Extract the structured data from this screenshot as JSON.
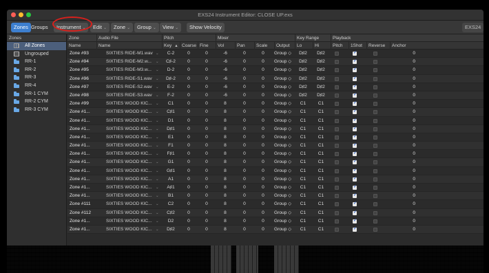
{
  "window": {
    "title": "EXS24 Instrument Editor: CLOSE UP.exs"
  },
  "toolbar": {
    "zones_label": "Zones",
    "groups_label": "Groups",
    "instrument_label": "Instrument",
    "edit_label": "Edit",
    "zone_label": "Zone",
    "group_label": "Group",
    "view_label": "View",
    "show_velocity_label": "Show Velocity",
    "badge": "EXS24"
  },
  "sidebar": {
    "header": "Zones",
    "items": [
      {
        "label": "All Zones",
        "icon": "grid-icon",
        "selected": true
      },
      {
        "label": "Ungrouped",
        "icon": "box-icon"
      },
      {
        "label": "RR-1",
        "icon": "folder-icon"
      },
      {
        "label": "RR-2",
        "icon": "folder-icon"
      },
      {
        "label": "RR-3",
        "icon": "folder-icon"
      },
      {
        "label": "RR-4",
        "icon": "folder-icon"
      },
      {
        "label": "RR-1 CYM",
        "icon": "folder-icon"
      },
      {
        "label": "RR-2 CYM",
        "icon": "folder-icon"
      },
      {
        "label": "RR-3 CYM",
        "icon": "folder-icon"
      }
    ]
  },
  "table": {
    "groups": {
      "zone": "Zone",
      "audio_file": "Audio File",
      "pitch": "Pitch",
      "mixer": "Mixer",
      "key_range": "Key Range",
      "playback": "Playback"
    },
    "columns": {
      "name": "Name",
      "file_name": "Name",
      "key": "Key",
      "coarse": "Coarse",
      "fine": "Fine",
      "vol": "Vol",
      "pan": "Pan",
      "scale": "Scale",
      "output": "Output",
      "lo": "Lo",
      "hi": "Hi",
      "pitch": "Pitch",
      "oneshot": "1Shot",
      "reverse": "Reverse",
      "anchor": "Anchor"
    },
    "rows": [
      {
        "zone": "Zone #93",
        "file": "SIXTIES RIDE-M1.wav",
        "key": "C-2",
        "coarse": "0",
        "fine": "0",
        "vol": "-6",
        "pan": "0",
        "scale": "0",
        "output": "Group ◇",
        "lo": "D♯2",
        "hi": "D♯2",
        "anchor": "0"
      },
      {
        "zone": "Zone #94",
        "file": "SIXTIES RIDE-M2.w...",
        "key": "C♯-2",
        "coarse": "0",
        "fine": "0",
        "vol": "-6",
        "pan": "0",
        "scale": "0",
        "output": "Group ◇",
        "lo": "D♯2",
        "hi": "D♯2",
        "anchor": "0"
      },
      {
        "zone": "Zone #95",
        "file": "SIXTIES RIDE-M3.w...",
        "key": "D-2",
        "coarse": "0",
        "fine": "0",
        "vol": "-6",
        "pan": "0",
        "scale": "0",
        "output": "Group ◇",
        "lo": "D♯2",
        "hi": "D♯2",
        "anchor": "0"
      },
      {
        "zone": "Zone #96",
        "file": "SIXTIES RIDE-S1.wav",
        "key": "D♯-2",
        "coarse": "0",
        "fine": "0",
        "vol": "-6",
        "pan": "0",
        "scale": "0",
        "output": "Group ◇",
        "lo": "D♯2",
        "hi": "D♯2",
        "anchor": "0"
      },
      {
        "zone": "Zone #97",
        "file": "SIXTIES RIDE-S2.wav",
        "key": "E-2",
        "coarse": "0",
        "fine": "0",
        "vol": "-6",
        "pan": "0",
        "scale": "0",
        "output": "Group ◇",
        "lo": "D♯2",
        "hi": "D♯2",
        "anchor": "0"
      },
      {
        "zone": "Zone #98",
        "file": "SIXTIES RIDE-S3.wav",
        "key": "F-2",
        "coarse": "0",
        "fine": "0",
        "vol": "-6",
        "pan": "0",
        "scale": "0",
        "output": "Group ◇",
        "lo": "D♯2",
        "hi": "D♯2",
        "anchor": "0"
      },
      {
        "zone": "Zone #99",
        "file": "SIXTIES WOOD KIC...",
        "key": "C1",
        "coarse": "0",
        "fine": "0",
        "vol": "8",
        "pan": "0",
        "scale": "0",
        "output": "Group ◇",
        "lo": "C1",
        "hi": "C1",
        "anchor": "0"
      },
      {
        "zone": "Zone #1...",
        "file": "SIXTIES WOOD KIC...",
        "key": "C♯1",
        "coarse": "0",
        "fine": "0",
        "vol": "8",
        "pan": "0",
        "scale": "0",
        "output": "Group ◇",
        "lo": "C1",
        "hi": "C1",
        "anchor": "0"
      },
      {
        "zone": "Zone #1...",
        "file": "SIXTIES WOOD KIC...",
        "key": "D1",
        "coarse": "0",
        "fine": "0",
        "vol": "8",
        "pan": "0",
        "scale": "0",
        "output": "Group ◇",
        "lo": "C1",
        "hi": "C1",
        "anchor": "0"
      },
      {
        "zone": "Zone #1...",
        "file": "SIXTIES WOOD KIC...",
        "key": "D♯1",
        "coarse": "0",
        "fine": "0",
        "vol": "8",
        "pan": "0",
        "scale": "0",
        "output": "Group ◇",
        "lo": "C1",
        "hi": "C1",
        "anchor": "0"
      },
      {
        "zone": "Zone #1...",
        "file": "SIXTIES WOOD KIC...",
        "key": "E1",
        "coarse": "0",
        "fine": "0",
        "vol": "8",
        "pan": "0",
        "scale": "0",
        "output": "Group ◇",
        "lo": "C1",
        "hi": "C1",
        "anchor": "0"
      },
      {
        "zone": "Zone #1...",
        "file": "SIXTIES WOOD KIC...",
        "key": "F1",
        "coarse": "0",
        "fine": "0",
        "vol": "8",
        "pan": "0",
        "scale": "0",
        "output": "Group ◇",
        "lo": "C1",
        "hi": "C1",
        "anchor": "0"
      },
      {
        "zone": "Zone #1...",
        "file": "SIXTIES WOOD KIC...",
        "key": "F♯1",
        "coarse": "0",
        "fine": "0",
        "vol": "8",
        "pan": "0",
        "scale": "0",
        "output": "Group ◇",
        "lo": "C1",
        "hi": "C1",
        "anchor": "0"
      },
      {
        "zone": "Zone #1...",
        "file": "SIXTIES WOOD KIC...",
        "key": "G1",
        "coarse": "0",
        "fine": "0",
        "vol": "8",
        "pan": "0",
        "scale": "0",
        "output": "Group ◇",
        "lo": "C1",
        "hi": "C1",
        "anchor": "0"
      },
      {
        "zone": "Zone #1...",
        "file": "SIXTIES WOOD KIC...",
        "key": "G♯1",
        "coarse": "0",
        "fine": "0",
        "vol": "8",
        "pan": "0",
        "scale": "0",
        "output": "Group ◇",
        "lo": "C1",
        "hi": "C1",
        "anchor": "0"
      },
      {
        "zone": "Zone #1...",
        "file": "SIXTIES WOOD KIC...",
        "key": "A1",
        "coarse": "0",
        "fine": "0",
        "vol": "8",
        "pan": "0",
        "scale": "0",
        "output": "Group ◇",
        "lo": "C1",
        "hi": "C1",
        "anchor": "0"
      },
      {
        "zone": "Zone #1...",
        "file": "SIXTIES WOOD KIC...",
        "key": "A♯1",
        "coarse": "0",
        "fine": "0",
        "vol": "8",
        "pan": "0",
        "scale": "0",
        "output": "Group ◇",
        "lo": "C1",
        "hi": "C1",
        "anchor": "0"
      },
      {
        "zone": "Zone #1...",
        "file": "SIXTIES WOOD KIC...",
        "key": "B1",
        "coarse": "0",
        "fine": "0",
        "vol": "8",
        "pan": "0",
        "scale": "0",
        "output": "Group ◇",
        "lo": "C1",
        "hi": "C1",
        "anchor": "0"
      },
      {
        "zone": "Zone #111",
        "file": "SIXTIES WOOD KIC...",
        "key": "C2",
        "coarse": "0",
        "fine": "0",
        "vol": "8",
        "pan": "0",
        "scale": "0",
        "output": "Group ◇",
        "lo": "C1",
        "hi": "C1",
        "anchor": "0"
      },
      {
        "zone": "Zone #112",
        "file": "SIXTIES WOOD KIC...",
        "key": "C♯2",
        "coarse": "0",
        "fine": "0",
        "vol": "8",
        "pan": "0",
        "scale": "0",
        "output": "Group ◇",
        "lo": "C1",
        "hi": "C1",
        "anchor": "0"
      },
      {
        "zone": "Zone #1...",
        "file": "SIXTIES WOOD KIC...",
        "key": "D2",
        "coarse": "0",
        "fine": "0",
        "vol": "8",
        "pan": "0",
        "scale": "0",
        "output": "Group ◇",
        "lo": "C1",
        "hi": "C1",
        "anchor": "0"
      },
      {
        "zone": "Zone #1...",
        "file": "SIXTIES WOOD KIC...",
        "key": "D♯2",
        "coarse": "0",
        "fine": "0",
        "vol": "8",
        "pan": "0",
        "scale": "0",
        "output": "Group ◇",
        "lo": "C1",
        "hi": "C1",
        "anchor": "0"
      }
    ]
  }
}
